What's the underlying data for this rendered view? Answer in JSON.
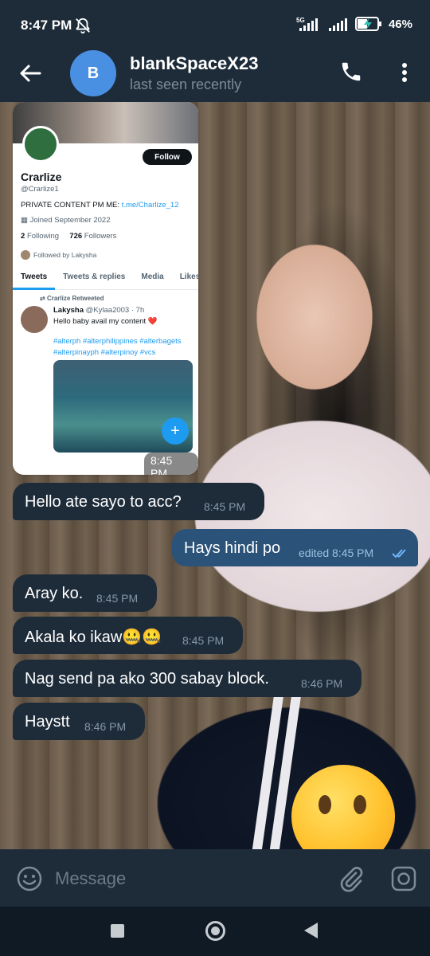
{
  "status_bar": {
    "time": "8:47 PM",
    "network": "5G",
    "battery": "46%"
  },
  "header": {
    "avatar_letter": "B",
    "name": "blankSpaceX23",
    "status": "last seen recently"
  },
  "media": {
    "profile_name": "Crarlize",
    "handle": "@Crarlize1",
    "follow_label": "Follow",
    "bio_prefix": "PRIVATE CONTENT PM ME: ",
    "bio_link": "t.me/Charlize_12",
    "joined": "Joined September 2022",
    "following_count": "2",
    "following_label": "Following",
    "followers_count": "726",
    "followers_label": "Followers",
    "followed_by": "Followed by Lakysha",
    "tabs": [
      "Tweets",
      "Tweets & replies",
      "Media",
      "Likes"
    ],
    "retweeted": "Crarlize Retweeted",
    "tweet_author": "Lakysha",
    "tweet_meta": "@Kylaa2003 · 7h",
    "tweet_text": "Hello baby avail my content ❤️",
    "tweet_tags": "#alterph #alterphilippines #alterbagets #alterpinayph #alterpinoy #vcs",
    "time": "8:45 PM"
  },
  "messages": [
    {
      "text": "Hello ate sayo to acc?",
      "time": "8:45 PM",
      "direction": "in"
    },
    {
      "text": "Hays hindi po",
      "time": "edited 8:45 PM",
      "direction": "out",
      "read": true
    },
    {
      "text": "Aray ko.",
      "time": "8:45 PM",
      "direction": "in"
    },
    {
      "text": "Akala ko ikaw🤐🤐",
      "time": "8:45 PM",
      "direction": "in"
    },
    {
      "text": "Nag send pa ako 300 sabay block.",
      "time": "8:46 PM",
      "direction": "in"
    },
    {
      "text": "Haystt",
      "time": "8:46 PM",
      "direction": "in"
    }
  ],
  "input": {
    "placeholder": "Message"
  },
  "colors": {
    "header_bg": "#1e2c3a",
    "bubble_in": "#1e2c3a",
    "bubble_out": "#2b5278",
    "accent": "#4a90e2",
    "twitter_blue": "#1d9bf0"
  }
}
